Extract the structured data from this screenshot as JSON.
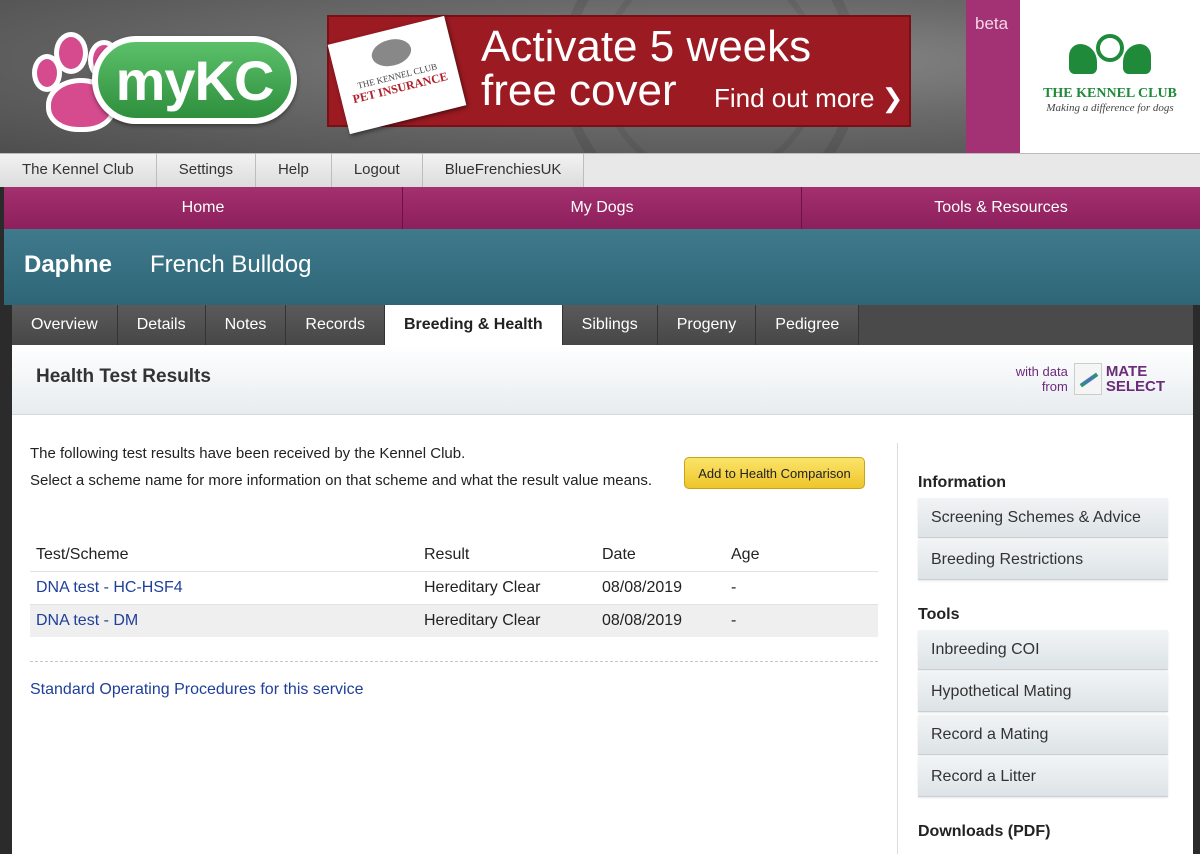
{
  "banner": {
    "logo_text": "myKC",
    "ad": {
      "card_line1": "THE KENNEL CLUB",
      "card_line2": "PET INSURANCE",
      "headline": "Activate 5 weeks free cover",
      "cta": "Find out more ❯"
    },
    "beta": "beta",
    "kc_name": "THE KENNEL CLUB",
    "kc_tagline": "Making a difference for dogs"
  },
  "toplinks": [
    "The Kennel Club",
    "Settings",
    "Help",
    "Logout",
    "BlueFrenchiesUK"
  ],
  "mainnav": [
    "Home",
    "My Dogs",
    "Tools & Resources"
  ],
  "dog": {
    "name": "Daphne",
    "breed": "French Bulldog"
  },
  "tabs": [
    "Overview",
    "Details",
    "Notes",
    "Records",
    "Breeding & Health",
    "Siblings",
    "Progeny",
    "Pedigree"
  ],
  "active_tab": "Breeding & Health",
  "panel": {
    "title": "Health Test Results",
    "mate": {
      "with_data": "with data",
      "from": "from",
      "brand_line1": "MATE",
      "brand_line2": "SELECT"
    },
    "intro1": "The following test results have been received by the Kennel Club.",
    "intro2": "Select a scheme name for more information on that scheme and what the result value means.",
    "add_button": "Add to Health Comparison",
    "table": {
      "headers": [
        "Test/Scheme",
        "Result",
        "Date",
        "Age"
      ],
      "rows": [
        [
          "DNA test - HC-HSF4",
          "Hereditary Clear",
          "08/08/2019",
          "-"
        ],
        [
          "DNA test - DM",
          "Hereditary Clear",
          "08/08/2019",
          "-"
        ]
      ]
    },
    "sop_link": "Standard Operating Procedures for this service"
  },
  "sidebar": {
    "information_heading": "Information",
    "information_links": [
      "Screening Schemes & Advice",
      "Breeding Restrictions"
    ],
    "tools_heading": "Tools",
    "tools_links": [
      "Inbreeding COI",
      "Hypothetical Mating",
      "Record a Mating",
      "Record a Litter"
    ],
    "downloads_heading": "Downloads (PDF)"
  }
}
